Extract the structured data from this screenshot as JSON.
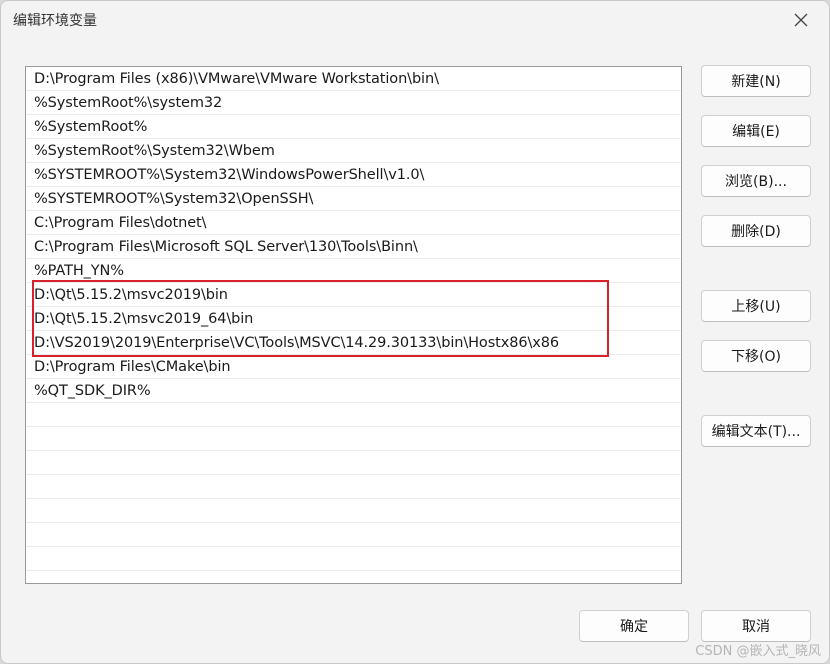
{
  "window": {
    "title": "编辑环境变量"
  },
  "paths": [
    "D:\\Program Files (x86)\\VMware\\VMware Workstation\\bin\\",
    "%SystemRoot%\\system32",
    "%SystemRoot%",
    "%SystemRoot%\\System32\\Wbem",
    "%SYSTEMROOT%\\System32\\WindowsPowerShell\\v1.0\\",
    "%SYSTEMROOT%\\System32\\OpenSSH\\",
    "C:\\Program Files\\dotnet\\",
    "C:\\Program Files\\Microsoft SQL Server\\130\\Tools\\Binn\\",
    "%PATH_YN%",
    "D:\\Qt\\5.15.2\\msvc2019\\bin",
    "D:\\Qt\\5.15.2\\msvc2019_64\\bin",
    "D:\\VS2019\\2019\\Enterprise\\VC\\Tools\\MSVC\\14.29.30133\\bin\\Hostx86\\x86",
    "D:\\Program Files\\CMake\\bin",
    "%QT_SDK_DIR%",
    "",
    "",
    "",
    "",
    "",
    "",
    "",
    ""
  ],
  "buttons": {
    "new": "新建(N)",
    "edit": "编辑(E)",
    "browse": "浏览(B)...",
    "delete": "删除(D)",
    "move_up": "上移(U)",
    "move_down": "下移(O)",
    "edit_text": "编辑文本(T)...",
    "ok": "确定",
    "cancel": "取消"
  },
  "watermark": "CSDN @嵌入式_晓风",
  "icons": {
    "close": "close-icon"
  },
  "colors": {
    "highlight_border": "#d7222b",
    "list_background": "#ffffff",
    "dialog_background": "#f3f3f3"
  }
}
